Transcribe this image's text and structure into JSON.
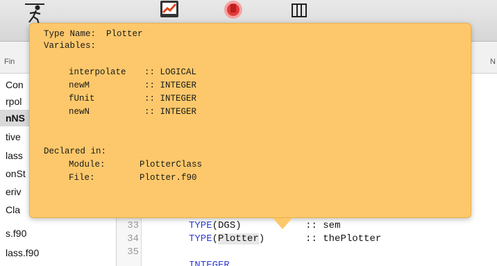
{
  "toolbar": {
    "icons": [
      "run-icon",
      "chart-icon",
      "stop-icon",
      "columns-icon"
    ]
  },
  "tabs": {
    "left": "Fin",
    "right": "N"
  },
  "sidebar": {
    "items": [
      {
        "label": "Con",
        "selected": false
      },
      {
        "label": "rpol",
        "selected": false
      },
      {
        "label": "nNS",
        "selected": true
      },
      {
        "label": "tive",
        "selected": false
      },
      {
        "label": "lass",
        "selected": false
      },
      {
        "label": "onSt",
        "selected": false
      },
      {
        "label": "eriv",
        "selected": false
      },
      {
        "label": "Cla",
        "selected": false
      },
      {
        "label": "s.f90",
        "selected": false
      },
      {
        "label": "lass.f90",
        "selected": false
      }
    ]
  },
  "editor": {
    "lines": [
      {
        "no": "33",
        "kw": "TYPE",
        "arg": "DGS",
        "spacer": "           ",
        "decl": ":: sem"
      },
      {
        "no": "34",
        "kw": "TYPE",
        "arg": "Plotter",
        "spacer": "       ",
        "decl": ":: thePlotter"
      },
      {
        "no": "35",
        "kw": "",
        "arg": "",
        "spacer": "",
        "decl": ""
      },
      {
        "no": "",
        "kw": "INTEGER",
        "arg": "",
        "spacer": "",
        "decl": ""
      }
    ]
  },
  "tooltip": {
    "type_name_label": "Type Name:",
    "type_name": "Plotter",
    "variables_label": "Variables:",
    "variables": [
      {
        "name": "interpolate",
        "type": ":: LOGICAL"
      },
      {
        "name": "newM",
        "type": ":: INTEGER"
      },
      {
        "name": "fUnit",
        "type": ":: INTEGER"
      },
      {
        "name": "newN",
        "type": ":: INTEGER"
      }
    ],
    "declared_in_label": "Declared in:",
    "module_label": "Module:",
    "module": "PlotterClass",
    "file_label": "File:",
    "file": "Plotter.f90"
  },
  "colors": {
    "tooltip_bg": "#fdc86b",
    "keyword": "#2e3cd6"
  }
}
